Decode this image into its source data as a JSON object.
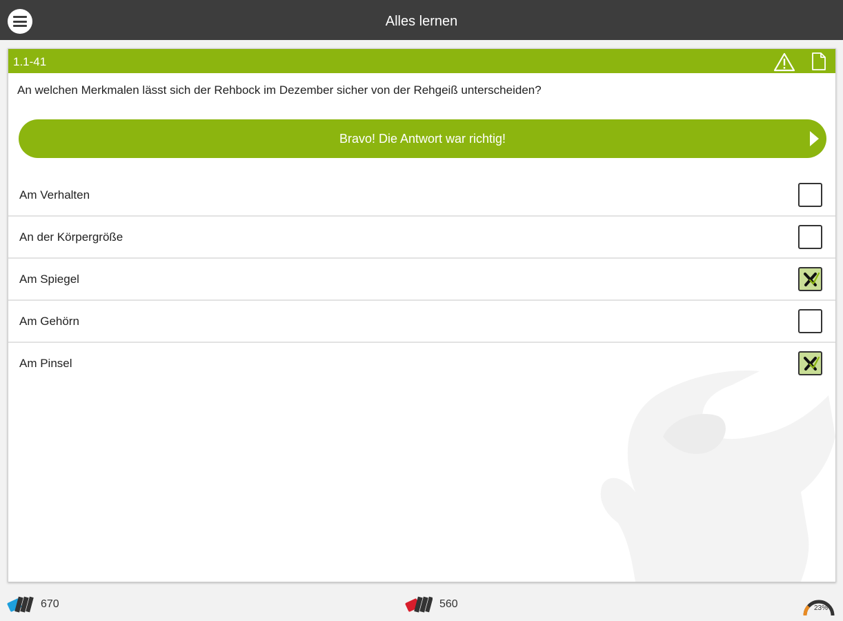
{
  "header": {
    "title": "Alles lernen"
  },
  "question": {
    "id": "1.1-41",
    "text": "An welchen Merkmalen lässt sich der Rehbock im Dezember sicher von der Rehgeiß unterscheiden?"
  },
  "feedback": {
    "label": "Bravo! Die Antwort war richtig!"
  },
  "answers": [
    {
      "label": "Am Verhalten",
      "checked": false
    },
    {
      "label": "An der Körpergröße",
      "checked": false
    },
    {
      "label": "Am Spiegel",
      "checked": true
    },
    {
      "label": "Am Gehörn",
      "checked": false
    },
    {
      "label": "Am Pinsel",
      "checked": true
    }
  ],
  "footer": {
    "left_count": "670",
    "center_count": "560",
    "progress_label": "23%",
    "progress": 0.23
  },
  "icons": [
    "menu-icon",
    "warning-icon",
    "document-icon",
    "checkmark-icon",
    "card-stack-blue-icon",
    "card-stack-red-icon",
    "progress-gauge-icon"
  ],
  "colors": {
    "topbar": "#3d3d3d",
    "accent": "#8cb50f",
    "check_fill": "#c9de96",
    "stack_left": "#1e9fdc",
    "stack_center": "#d81e2c",
    "gauge": "#e98b23"
  }
}
